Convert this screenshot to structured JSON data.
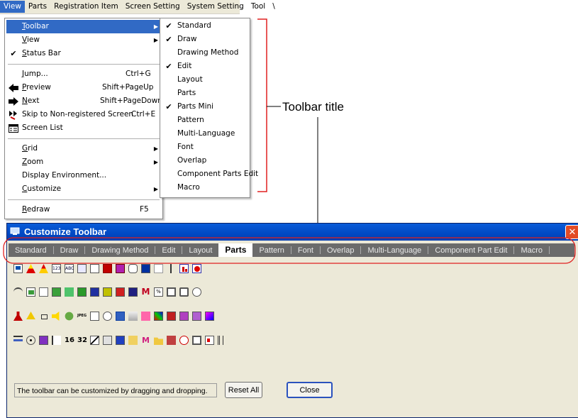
{
  "menubar": {
    "items": [
      "View",
      "Parts",
      "Registration Item",
      "Screen Setting",
      "System Setting",
      "Tool",
      "\\"
    ]
  },
  "view_menu": {
    "items": [
      {
        "label": "Toolbar",
        "accel": "T",
        "rest": "oolbar",
        "submenu": true
      },
      {
        "label": "View",
        "accel": "V",
        "rest": "iew",
        "submenu": true
      },
      {
        "label": "Status Bar",
        "accel": "S",
        "rest": "tatus Bar",
        "checked": true
      },
      {
        "label": "Jump...",
        "accel": "J",
        "rest": "ump...",
        "shortcut": "Ctrl+G"
      },
      {
        "label": "Preview",
        "accel": "P",
        "rest": "review",
        "shortcut": "Shift+PageUp",
        "icon": "arrow-left-icon"
      },
      {
        "label": "Next",
        "accel": "N",
        "rest": "ext",
        "shortcut": "Shift+PageDown",
        "icon": "arrow-right-icon"
      },
      {
        "label": "Skip to Non-registered Screen",
        "accel": "k",
        "shortcut": "Ctrl+E",
        "icon": "skip-icon"
      },
      {
        "label": "Screen List",
        "accel": "L",
        "icon": "screen-list-icon"
      },
      {
        "label": "Grid",
        "accel": "G",
        "rest": "rid",
        "submenu": true
      },
      {
        "label": "Zoom",
        "accel": "Z",
        "rest": "oom",
        "submenu": true
      },
      {
        "label": "Display Environment..."
      },
      {
        "label": "Customize",
        "accel": "C",
        "rest": "ustomize",
        "submenu": true
      },
      {
        "label": "Redraw",
        "accel": "R",
        "rest": "edraw",
        "shortcut": "F5"
      }
    ]
  },
  "toolbar_submenu": {
    "items": [
      {
        "label": "Standard",
        "checked": true
      },
      {
        "label": "Draw",
        "checked": true
      },
      {
        "label": "Drawing Method",
        "checked": false
      },
      {
        "label": "Edit",
        "checked": true
      },
      {
        "label": "Layout",
        "checked": false
      },
      {
        "label": "Parts",
        "checked": false
      },
      {
        "label": "Parts Mini",
        "checked": true
      },
      {
        "label": "Pattern",
        "checked": false
      },
      {
        "label": "Multi-Language",
        "checked": false
      },
      {
        "label": "Font",
        "checked": false
      },
      {
        "label": "Overlap",
        "checked": false
      },
      {
        "label": "Component Parts Edit",
        "checked": false
      },
      {
        "label": "Macro",
        "checked": false
      }
    ]
  },
  "callout": {
    "label": "Toolbar title"
  },
  "dialog": {
    "title": "Customize Toolbar",
    "close_glyph": "✕",
    "tabs": [
      "Standard",
      "Draw",
      "Drawing Method",
      "Edit",
      "Layout",
      "Parts",
      "Pattern",
      "Font",
      "Overlap",
      "Multi-Language",
      "Component Part Edit",
      "Macro"
    ],
    "selected_tab": "Parts",
    "status_text": "The toolbar can be customized by dragging and dropping.",
    "reset_label": "Reset All",
    "close_label": "Close"
  },
  "colors": {
    "menu_highlight": "#316ac5",
    "callout_red": "#e02020",
    "title_bar": "#0054e3",
    "tab_strip": "#6b6b6b"
  }
}
